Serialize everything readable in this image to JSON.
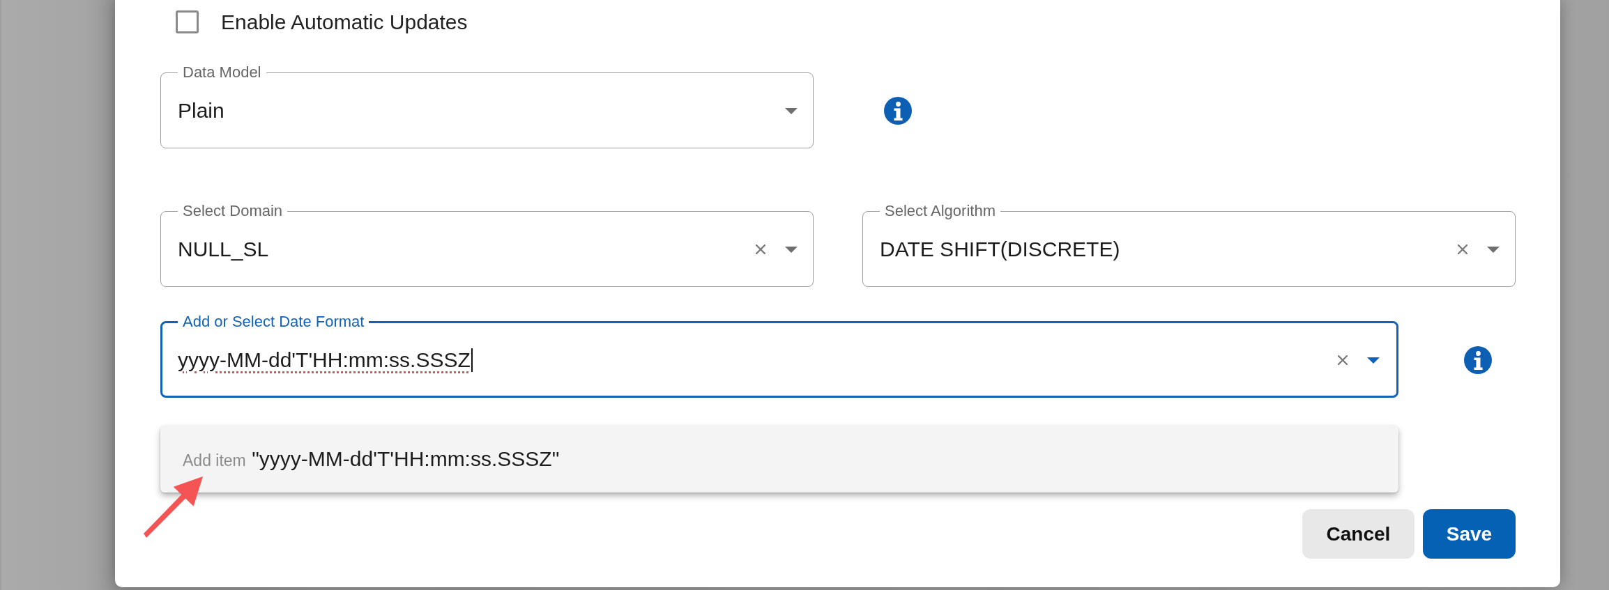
{
  "checkbox": {
    "label": "Enable Automatic Updates",
    "checked": false
  },
  "rows": [
    {
      "info": true,
      "fields": [
        {
          "kind": "select",
          "label": "Data Model",
          "value": "Plain",
          "clearable": false,
          "focused": false
        }
      ]
    },
    {
      "info": false,
      "fields": [
        {
          "kind": "select",
          "label": "Select Domain",
          "value": "NULL_SL",
          "clearable": true,
          "focused": false
        },
        {
          "kind": "select",
          "label": "Select Algorithm",
          "value": "DATE SHIFT(DISCRETE)",
          "clearable": true,
          "focused": false
        }
      ]
    },
    {
      "info": true,
      "fields": [
        {
          "kind": "combobox",
          "label": "Add or Select Date Format",
          "value": "yyyy-MM-dd'T'HH:mm:ss.SSSZ",
          "clearable": true,
          "focused": true
        }
      ],
      "dropdown": {
        "options": [
          {
            "hint": "Add item",
            "text": "\"yyyy-MM-dd'T'HH:mm:ss.SSSZ\""
          }
        ]
      }
    }
  ],
  "buttons": [
    {
      "label": "Cancel",
      "kind": "secondary"
    },
    {
      "label": "Save",
      "kind": "primary"
    }
  ]
}
